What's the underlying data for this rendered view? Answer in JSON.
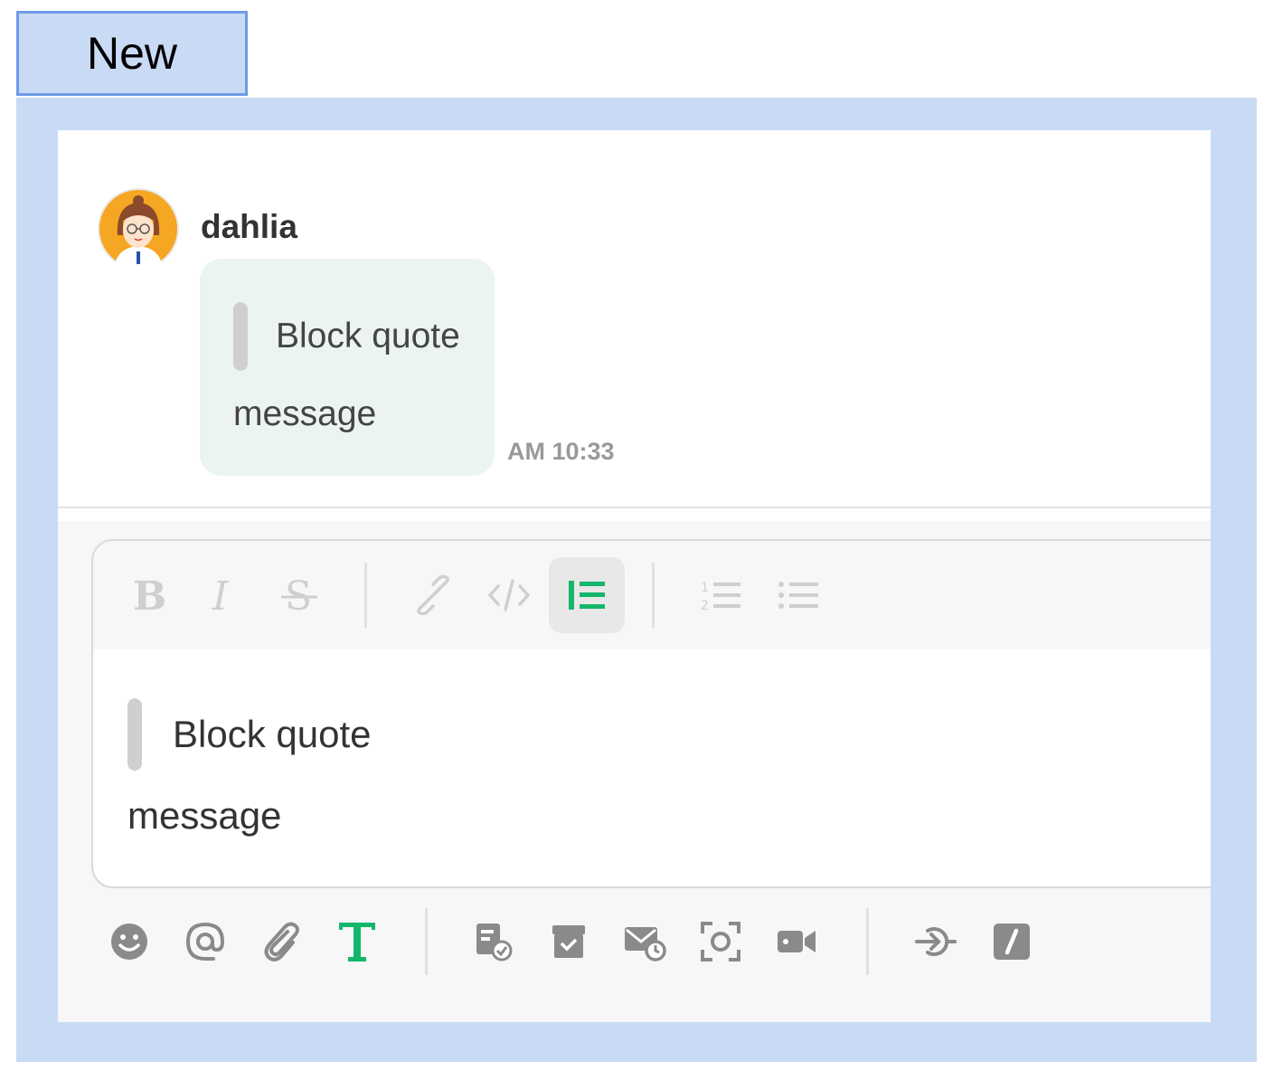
{
  "header": {
    "tab_label": "New"
  },
  "message": {
    "sender": "dahlia",
    "quote": "Block quote",
    "text": "message",
    "time": "AM 10:33"
  },
  "composer": {
    "quote": "Block quote",
    "text": "message",
    "format_toolbar": [
      {
        "name": "bold-icon",
        "active": false
      },
      {
        "name": "italic-icon",
        "active": false
      },
      {
        "name": "strikethrough-icon",
        "active": false
      },
      {
        "name": "link-icon",
        "active": false
      },
      {
        "name": "code-icon",
        "active": false
      },
      {
        "name": "block-quote-icon",
        "active": true
      },
      {
        "name": "ordered-list-icon",
        "active": false
      },
      {
        "name": "bullet-list-icon",
        "active": false
      }
    ],
    "action_toolbar": [
      "emoji-icon",
      "mention-icon",
      "attachment-icon",
      "text-format-icon",
      "task-icon",
      "archive-icon",
      "scheduled-mail-icon",
      "screenshot-icon",
      "video-call-icon",
      "integration-icon",
      "slash-command-icon"
    ]
  },
  "colors": {
    "accent_green": "#12b76a",
    "frame_blue": "#c9daf5",
    "tab_border": "#6f9be6",
    "bubble_bg": "#ebf4f1"
  }
}
